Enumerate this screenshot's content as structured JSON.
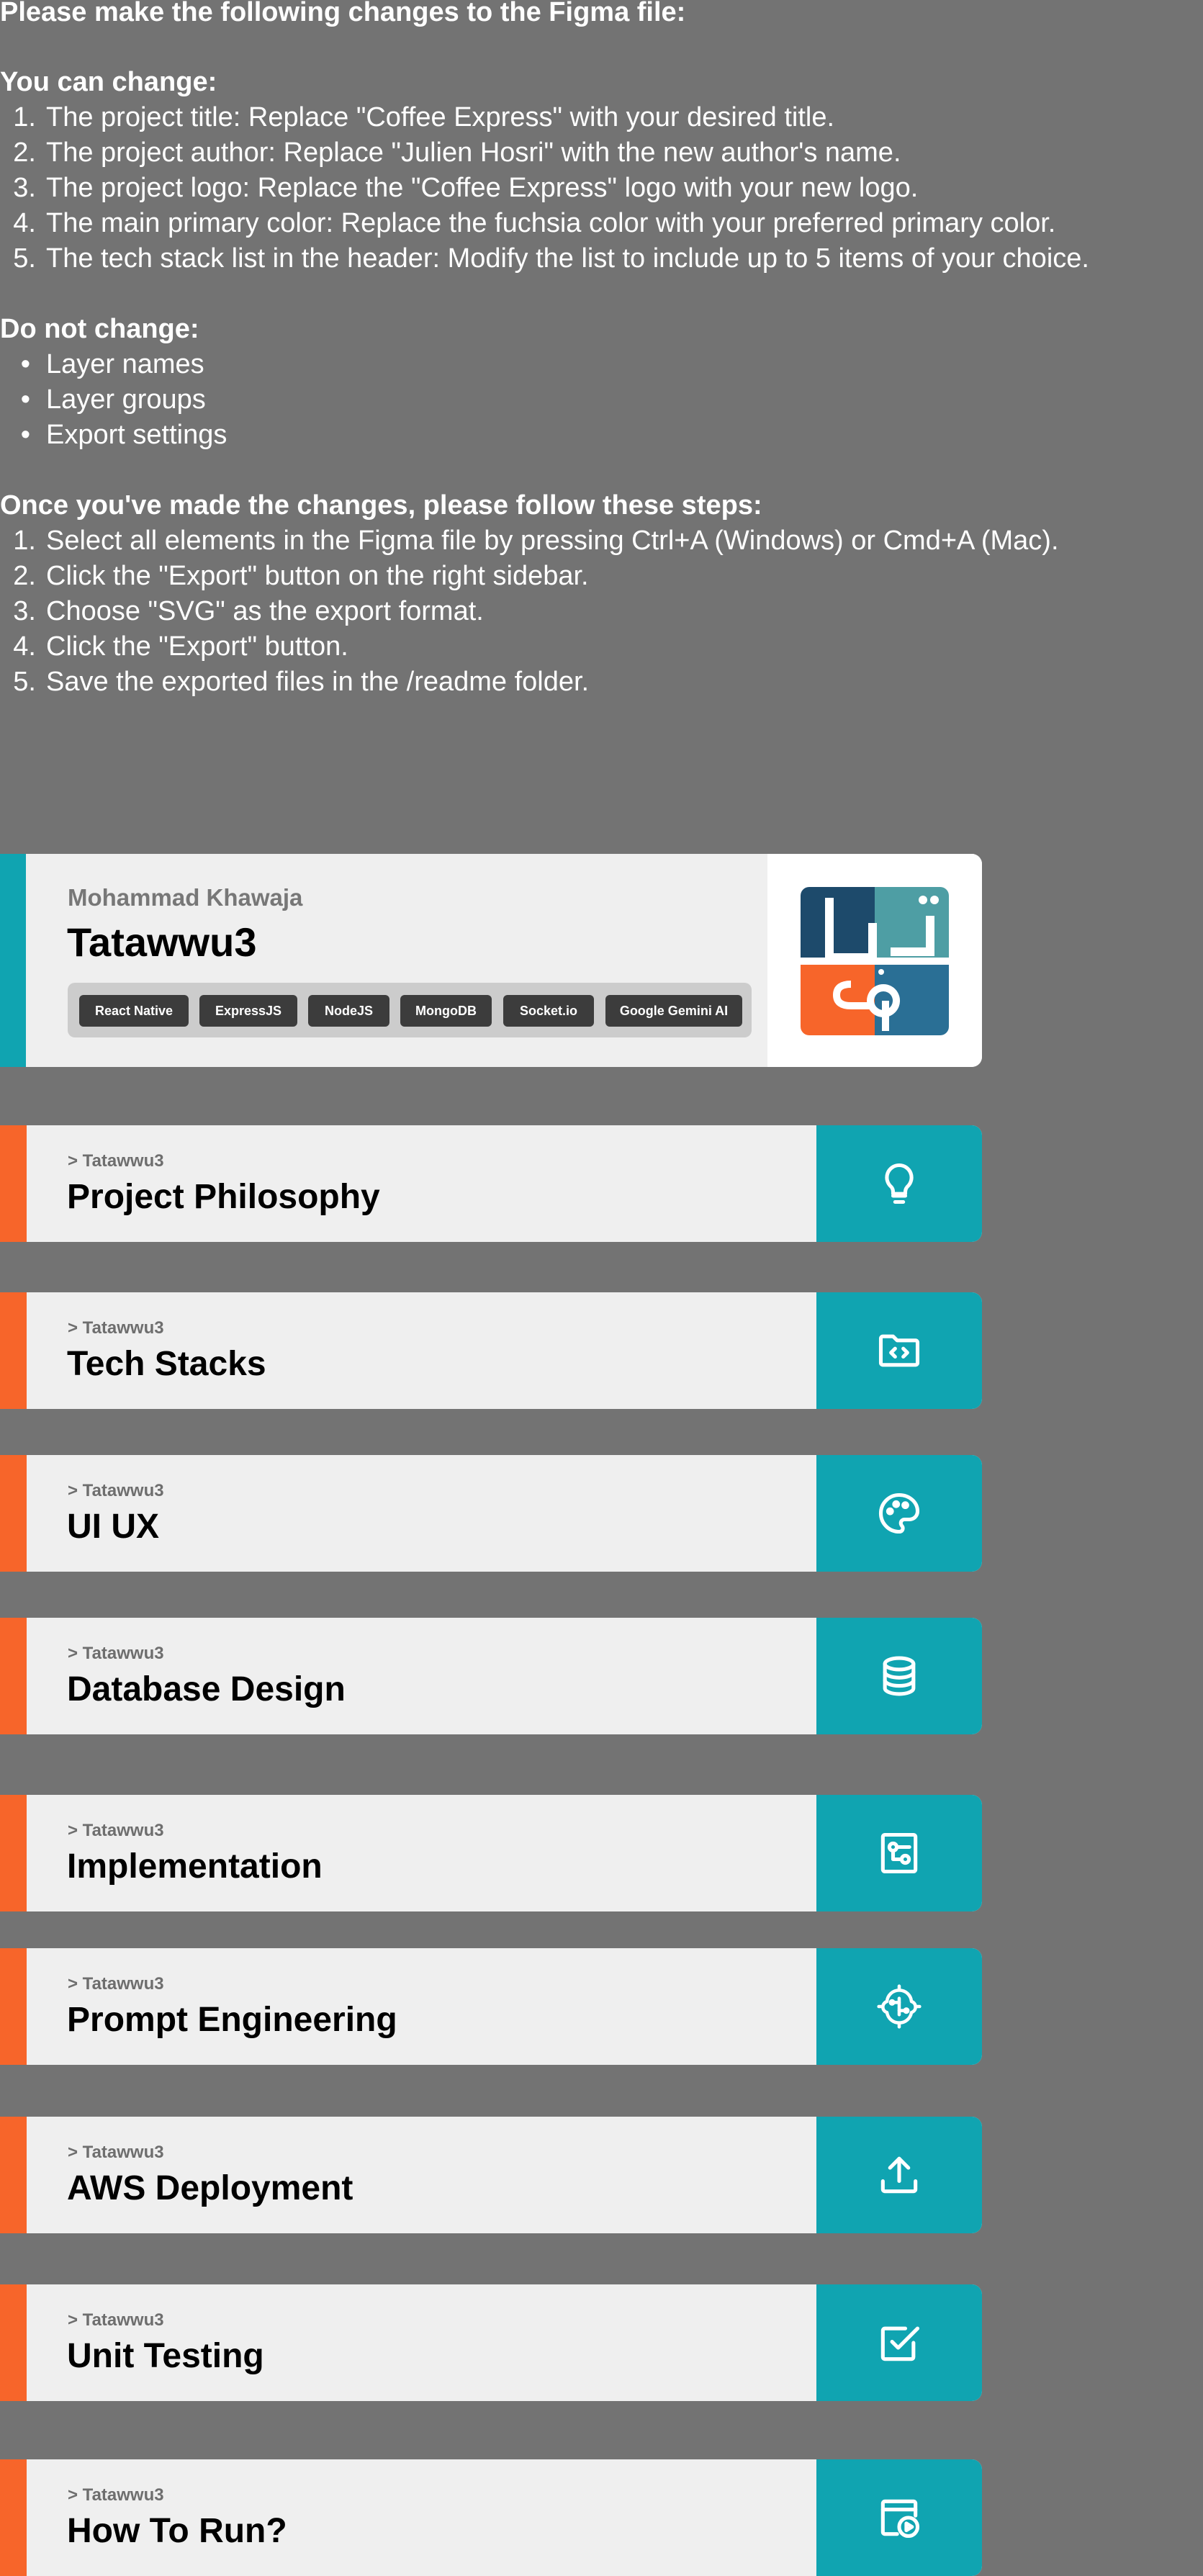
{
  "instructions": {
    "heading": "Please make the following changes to the Figma file:",
    "can_change_heading": "You can change:",
    "can_change": [
      "The project title: Replace \"Coffee Express\" with your desired title.",
      "The project author: Replace \"Julien Hosri\" with the new author's name.",
      "The project logo: Replace the \"Coffee Express\" logo with your new logo.",
      "The main primary color: Replace the fuchsia color with your preferred primary color.",
      "The tech stack list in the header: Modify the list to include up to 5 items of your choice."
    ],
    "do_not_change_heading": "Do not change:",
    "do_not_change": [
      "Layer names",
      "Layer groups",
      "Export settings"
    ],
    "steps_heading": "Once you've made the changes, please follow these steps:",
    "steps": [
      "Select all elements in the Figma file by pressing Ctrl+A (Windows) or Cmd+A (Mac).",
      "Click the \"Export\" button on the right sidebar.",
      "Choose \"SVG\" as the export format.",
      "Click the \"Export\" button.",
      "Save the exported files in the /readme folder."
    ]
  },
  "header": {
    "author": "Mohammad Khawaja",
    "title": "Tatawwu3",
    "tech_stack": [
      "React Native",
      "ExpressJS",
      "NodeJS",
      "MongoDB",
      "Socket.io",
      "Google Gemini AI"
    ],
    "logo_icon": "tatawwu3-logo"
  },
  "sections": [
    {
      "crumb": "> Tatawwu3",
      "title": "Project Philosophy",
      "icon": "lightbulb-icon"
    },
    {
      "crumb": "> Tatawwu3",
      "title": "Tech Stacks",
      "icon": "code-folder-icon"
    },
    {
      "crumb": "> Tatawwu3",
      "title": "UI UX",
      "icon": "palette-icon"
    },
    {
      "crumb": "> Tatawwu3",
      "title": "Database Design",
      "icon": "database-icon"
    },
    {
      "crumb": "> Tatawwu3",
      "title": "Implementation",
      "icon": "workflow-icon"
    },
    {
      "crumb": "> Tatawwu3",
      "title": "Prompt Engineering",
      "icon": "ai-chip-icon"
    },
    {
      "crumb": "> Tatawwu3",
      "title": "AWS Deployment",
      "icon": "upload-icon"
    },
    {
      "crumb": "> Tatawwu3",
      "title": "Unit Testing",
      "icon": "checkbox-icon"
    },
    {
      "crumb": "> Tatawwu3",
      "title": "How To Run?",
      "icon": "play-window-icon"
    }
  ],
  "colors": {
    "background": "#737373",
    "primary": "#10a4b1",
    "accent": "#f7652a",
    "card": "#efefef",
    "chip": "#3c3c3c"
  }
}
